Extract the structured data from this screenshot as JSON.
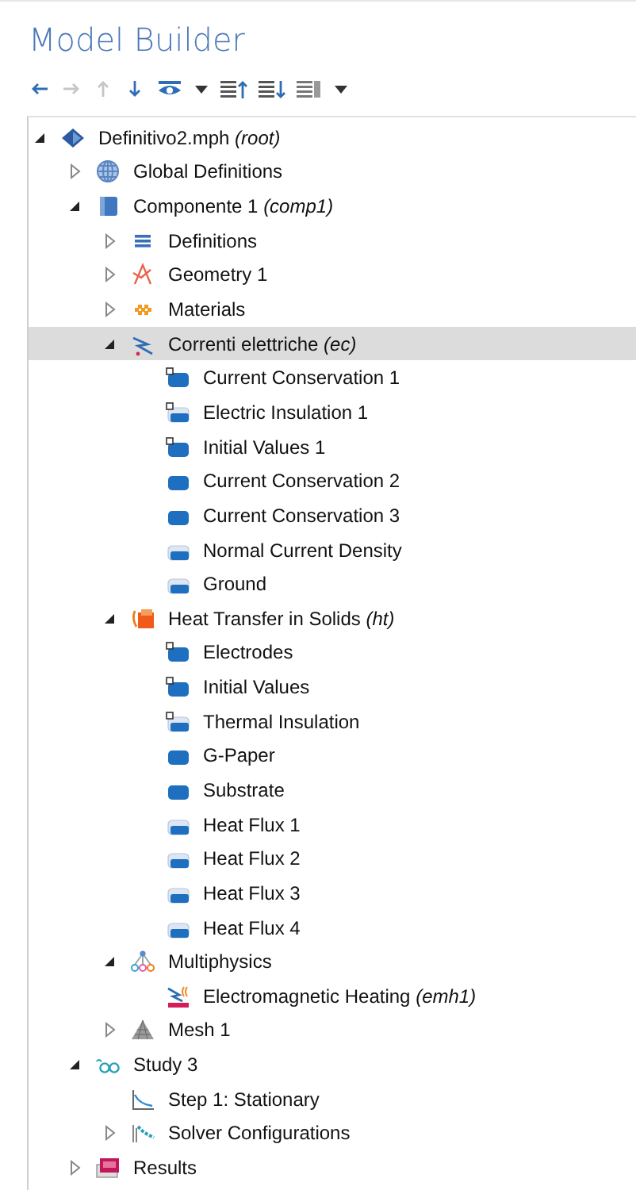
{
  "title": "Model Builder",
  "toolbar": [
    {
      "kind": "back",
      "disabled": false
    },
    {
      "kind": "forward",
      "disabled": true
    },
    {
      "kind": "up",
      "disabled": true
    },
    {
      "kind": "down",
      "disabled": false
    },
    {
      "kind": "eye",
      "disabled": false
    },
    {
      "kind": "caret",
      "disabled": false
    },
    {
      "kind": "collapse",
      "disabled": false
    },
    {
      "kind": "expand",
      "disabled": false
    },
    {
      "kind": "list",
      "disabled": false
    },
    {
      "kind": "caret",
      "disabled": false
    }
  ],
  "tree": [
    {
      "label": "Definitivo2.mph *(root)*",
      "kind": "model",
      "expanded": true,
      "selected": false,
      "children": [
        {
          "label": "Global Definitions",
          "kind": "globe",
          "expanded": false,
          "selected": false
        },
        {
          "label": "Componente 1 *(comp1)*",
          "kind": "component",
          "expanded": true,
          "selected": false,
          "children": [
            {
              "label": "Definitions",
              "kind": "definitions",
              "expanded": false,
              "selected": false
            },
            {
              "label": "Geometry 1",
              "kind": "geometry",
              "expanded": false,
              "selected": false
            },
            {
              "label": "Materials",
              "kind": "materials",
              "expanded": false,
              "selected": false
            },
            {
              "label": "Correnti elettriche *(ec)*",
              "kind": "electric",
              "expanded": true,
              "selected": true,
              "children": [
                {
                  "label": "Current Conservation 1",
                  "kind": "domaindefault",
                  "selected": false
                },
                {
                  "label": "Electric Insulation 1",
                  "kind": "boundarydefault",
                  "selected": false
                },
                {
                  "label": "Initial Values 1",
                  "kind": "domaindefault",
                  "selected": false
                },
                {
                  "label": "Current Conservation 2",
                  "kind": "domain",
                  "selected": false
                },
                {
                  "label": "Current Conservation 3",
                  "kind": "domain",
                  "selected": false
                },
                {
                  "label": "Normal Current Density",
                  "kind": "boundary",
                  "selected": false
                },
                {
                  "label": "Ground",
                  "kind": "boundary",
                  "selected": false
                }
              ]
            },
            {
              "label": "Heat Transfer in Solids *(ht)*",
              "kind": "heat",
              "expanded": true,
              "selected": false,
              "children": [
                {
                  "label": "Electrodes",
                  "kind": "domaindefault",
                  "selected": false
                },
                {
                  "label": "Initial Values",
                  "kind": "domaindefault",
                  "selected": false
                },
                {
                  "label": "Thermal Insulation",
                  "kind": "boundarydefault",
                  "selected": false
                },
                {
                  "label": "G-Paper",
                  "kind": "domain",
                  "selected": false
                },
                {
                  "label": "Substrate",
                  "kind": "domain",
                  "selected": false
                },
                {
                  "label": "Heat Flux 1",
                  "kind": "boundary",
                  "selected": false
                },
                {
                  "label": "Heat Flux 2",
                  "kind": "boundary",
                  "selected": false
                },
                {
                  "label": "Heat Flux 3",
                  "kind": "boundary",
                  "selected": false
                },
                {
                  "label": "Heat Flux 4",
                  "kind": "boundary",
                  "selected": false
                }
              ]
            },
            {
              "label": "Multiphysics",
              "kind": "multiphysics",
              "expanded": true,
              "selected": false,
              "children": [
                {
                  "label": "Electromagnetic Heating *(emh1)*",
                  "kind": "emheating",
                  "selected": false
                }
              ]
            },
            {
              "label": "Mesh 1",
              "kind": "mesh",
              "expanded": false,
              "selected": false
            }
          ]
        },
        {
          "label": "Study 3",
          "kind": "study",
          "expanded": true,
          "selected": false,
          "children": [
            {
              "label": "Step 1: Stationary",
              "kind": "step",
              "selected": false
            },
            {
              "label": "Solver Configurations",
              "kind": "solver",
              "expanded": false,
              "selected": false
            }
          ]
        },
        {
          "label": "Results",
          "kind": "results",
          "expanded": false,
          "selected": false
        }
      ]
    }
  ]
}
